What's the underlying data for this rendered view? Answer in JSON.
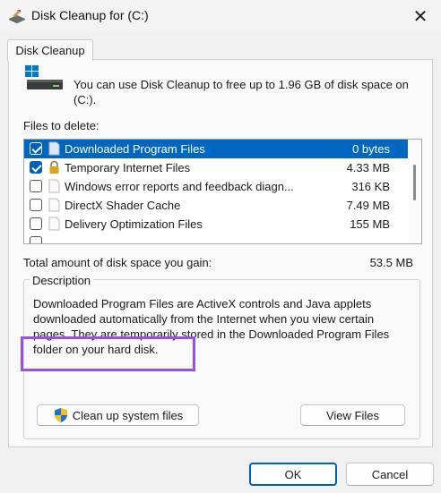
{
  "window": {
    "title": "Disk Cleanup for  (C:)",
    "close_glyph": "✕"
  },
  "tab": {
    "label": "Disk Cleanup"
  },
  "intro_text": "You can use Disk Cleanup to free up to 1.96 GB of disk space on (C:).",
  "files_label": "Files to delete:",
  "files": [
    {
      "name": "Downloaded Program Files",
      "size": "0 bytes",
      "checked": true,
      "selected": true,
      "icon": "file-icon"
    },
    {
      "name": "Temporary Internet Files",
      "size": "4.33 MB",
      "checked": true,
      "selected": false,
      "icon": "lock-icon"
    },
    {
      "name": "Windows error reports and feedback diagn...",
      "size": "316 KB",
      "checked": false,
      "selected": false,
      "icon": "file-icon"
    },
    {
      "name": "DirectX Shader Cache",
      "size": "7.49 MB",
      "checked": false,
      "selected": false,
      "icon": "file-icon"
    },
    {
      "name": "Delivery Optimization Files",
      "size": "155 MB",
      "checked": false,
      "selected": false,
      "icon": "file-icon"
    }
  ],
  "total_label": "Total amount of disk space you gain:",
  "total_value": "53.5 MB",
  "description": {
    "legend": "Description",
    "text": "Downloaded Program Files are ActiveX controls and Java applets downloaded automatically from the Internet when you view certain pages. They are temporarily stored in the Downloaded Program Files folder on your hard disk."
  },
  "buttons": {
    "cleanup_system": "Clean up system files",
    "view_files": "View Files",
    "ok": "OK",
    "cancel": "Cancel"
  },
  "colors": {
    "selection": "#0067c0",
    "highlight": "#9b51e0",
    "accent": "#005fb8"
  }
}
